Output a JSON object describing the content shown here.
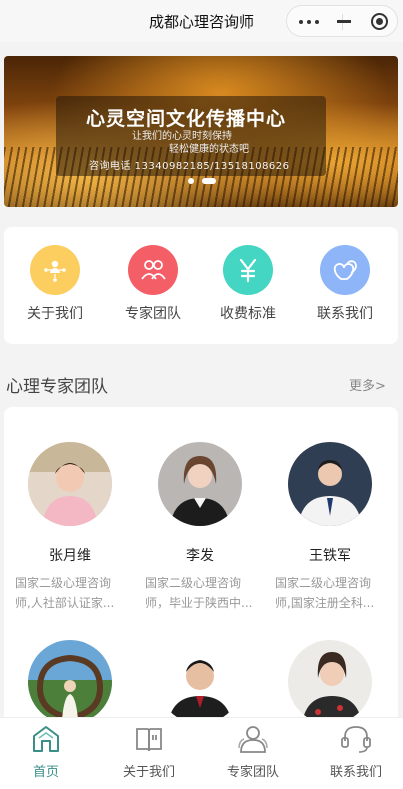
{
  "window": {
    "title": "成都心理咨询师"
  },
  "banner": {
    "headline": "心灵空间文化传播中心",
    "subline1": "让我们的心灵时刻保持",
    "subline2": "轻松健康的状态吧",
    "phone": "咨询电话  13340982185/13518108626",
    "slide_count": 2,
    "active_slide": 2
  },
  "nav": {
    "items": [
      {
        "label": "关于我们",
        "icon": "people-network-icon",
        "color": "#fcce5f"
      },
      {
        "label": "专家团队",
        "icon": "team-icon",
        "color": "#f35e67"
      },
      {
        "label": "收费标准",
        "icon": "yen-icon",
        "color": "#45d6c3"
      },
      {
        "label": "联系我们",
        "icon": "hearts-icon",
        "color": "#8db5f8"
      }
    ]
  },
  "section": {
    "title": "心理专家团队",
    "more": "更多>"
  },
  "experts": [
    {
      "name": "张月维",
      "desc1": "国家二级心理咨询",
      "desc2": "师,人社部认证家..."
    },
    {
      "name": "李发",
      "desc1": "国家二级心理咨询",
      "desc2": "师，毕业于陕西中..."
    },
    {
      "name": "王铁军",
      "desc1": "国家二级心理咨询",
      "desc2": "师,国家注册全科..."
    },
    {
      "name": "",
      "desc1": "",
      "desc2": ""
    },
    {
      "name": "",
      "desc1": "",
      "desc2": ""
    },
    {
      "name": "",
      "desc1": "",
      "desc2": ""
    }
  ],
  "tabbar": {
    "items": [
      {
        "label": "首页",
        "icon": "home-icon",
        "active": true
      },
      {
        "label": "关于我们",
        "icon": "book-icon",
        "active": false
      },
      {
        "label": "专家团队",
        "icon": "users-icon",
        "active": false
      },
      {
        "label": "联系我们",
        "icon": "headset-icon",
        "active": false
      }
    ],
    "active_color": "#3a8f86"
  }
}
